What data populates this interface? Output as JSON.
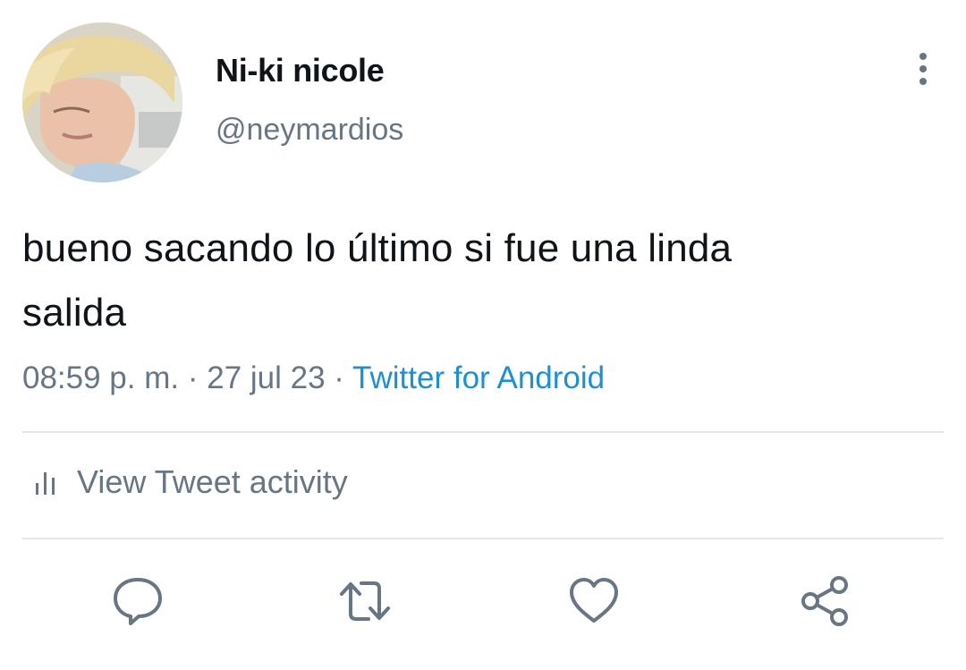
{
  "user": {
    "display_name": "Ni-ki nicole",
    "handle": "@neymardios",
    "avatar_icon": "profile-photo"
  },
  "tweet": {
    "text_line1": "bueno sacando lo último si fue una linda",
    "text_line2": "salida",
    "time": "08:59 p. m.",
    "separator": "·",
    "date": "27 jul 23",
    "source": "Twitter for Android"
  },
  "activity": {
    "label": "View Tweet activity",
    "icon": "bar-chart-icon"
  },
  "actions": {
    "reply_icon": "comment-icon",
    "retweet_icon": "retweet-icon",
    "like_icon": "heart-icon",
    "share_icon": "share-icon"
  },
  "colors": {
    "text_primary": "#0f1419",
    "text_secondary": "#687684",
    "link": "#1d8fd6",
    "divider": "#e4e8eb"
  }
}
